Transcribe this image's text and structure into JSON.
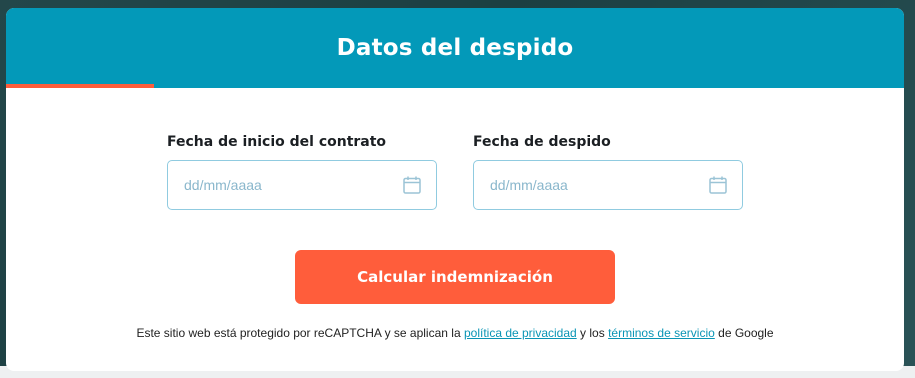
{
  "card": {
    "title": "Datos del despido",
    "progress_fraction": 0.165,
    "colors": {
      "header": "#0399b9",
      "accent": "#ff5d3b"
    }
  },
  "form": {
    "start_date": {
      "label": "Fecha de inicio del contrato",
      "placeholder": "dd/mm/aaaa",
      "icon": "calendar-icon"
    },
    "dismissal_date": {
      "label": "Fecha de despido",
      "placeholder": "dd/mm/aaaa",
      "icon": "calendar-icon"
    },
    "submit_label": "Calcular indemnización"
  },
  "recaptcha": {
    "prefix": "Este sitio web está protegido por reCAPTCHA y se aplican la",
    "privacy_link": "política de privacidad",
    "middle": "y los",
    "terms_link": "términos de servicio",
    "suffix": "de Google"
  }
}
